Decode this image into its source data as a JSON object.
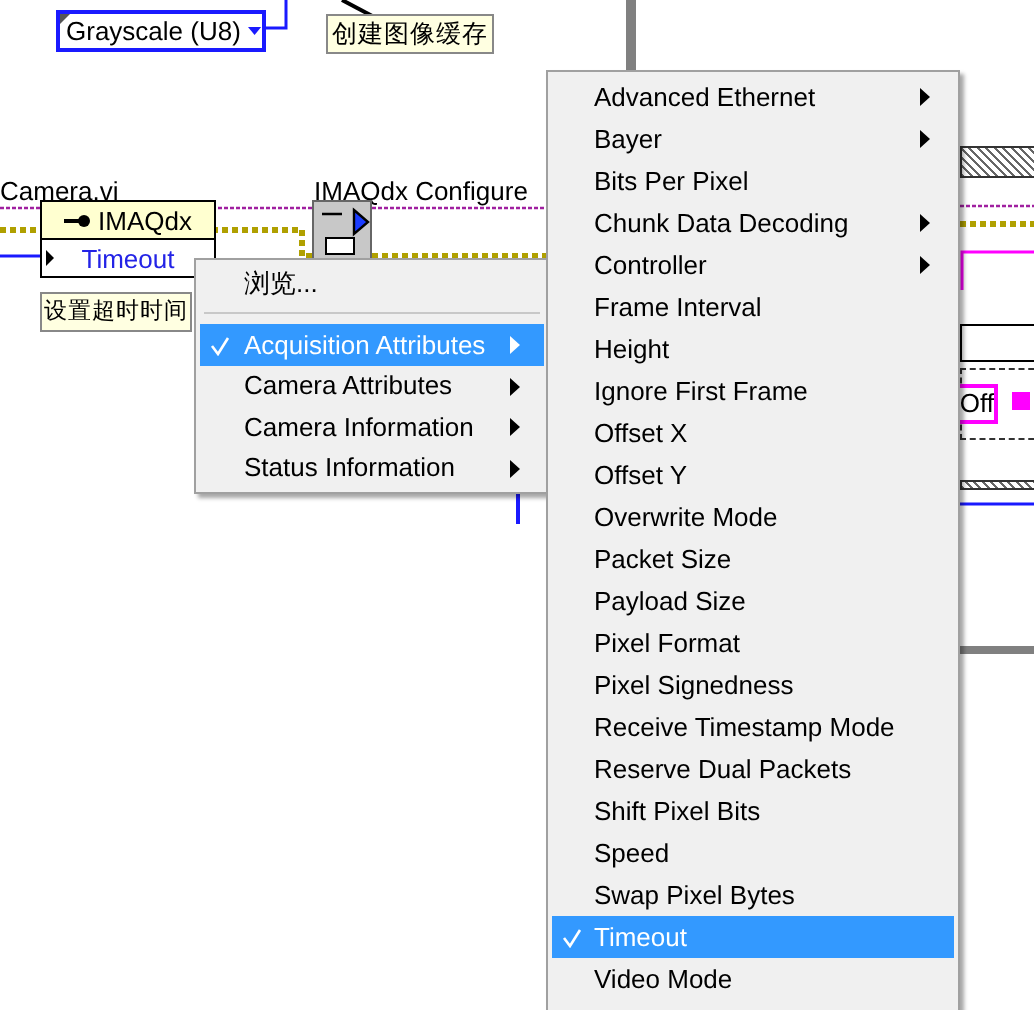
{
  "diagram": {
    "enum_constant": {
      "value": "Grayscale (U8)"
    },
    "buffer_label": "创建图像缓存",
    "vi_name": "Camera.vi",
    "property_node": {
      "class_name": "IMAQdx",
      "property": "Timeout"
    },
    "timeout_label": "设置超时时间",
    "subvi_label": "IMAQdx Configure",
    "ring_value": "Off"
  },
  "context_menu": {
    "items": [
      {
        "label": "浏览...",
        "checked": false,
        "selected": false,
        "has_submenu": false
      },
      {
        "label": "Acquisition Attributes",
        "checked": true,
        "selected": true,
        "has_submenu": true
      },
      {
        "label": "Camera Attributes",
        "checked": false,
        "selected": false,
        "has_submenu": true
      },
      {
        "label": "Camera Information",
        "checked": false,
        "selected": false,
        "has_submenu": true
      },
      {
        "label": "Status Information",
        "checked": false,
        "selected": false,
        "has_submenu": true
      }
    ]
  },
  "submenu": {
    "items": [
      {
        "label": "Advanced Ethernet",
        "checked": false,
        "selected": false,
        "has_submenu": true
      },
      {
        "label": "Bayer",
        "checked": false,
        "selected": false,
        "has_submenu": true
      },
      {
        "label": "Bits Per Pixel",
        "checked": false,
        "selected": false,
        "has_submenu": false
      },
      {
        "label": "Chunk Data Decoding",
        "checked": false,
        "selected": false,
        "has_submenu": true
      },
      {
        "label": "Controller",
        "checked": false,
        "selected": false,
        "has_submenu": true
      },
      {
        "label": "Frame Interval",
        "checked": false,
        "selected": false,
        "has_submenu": false
      },
      {
        "label": "Height",
        "checked": false,
        "selected": false,
        "has_submenu": false
      },
      {
        "label": "Ignore First Frame",
        "checked": false,
        "selected": false,
        "has_submenu": false
      },
      {
        "label": "Offset X",
        "checked": false,
        "selected": false,
        "has_submenu": false
      },
      {
        "label": "Offset Y",
        "checked": false,
        "selected": false,
        "has_submenu": false
      },
      {
        "label": "Overwrite Mode",
        "checked": false,
        "selected": false,
        "has_submenu": false
      },
      {
        "label": "Packet Size",
        "checked": false,
        "selected": false,
        "has_submenu": false
      },
      {
        "label": "Payload Size",
        "checked": false,
        "selected": false,
        "has_submenu": false
      },
      {
        "label": "Pixel Format",
        "checked": false,
        "selected": false,
        "has_submenu": false
      },
      {
        "label": "Pixel Signedness",
        "checked": false,
        "selected": false,
        "has_submenu": false
      },
      {
        "label": "Receive Timestamp Mode",
        "checked": false,
        "selected": false,
        "has_submenu": false
      },
      {
        "label": "Reserve Dual Packets",
        "checked": false,
        "selected": false,
        "has_submenu": false
      },
      {
        "label": "Shift Pixel Bits",
        "checked": false,
        "selected": false,
        "has_submenu": false
      },
      {
        "label": "Speed",
        "checked": false,
        "selected": false,
        "has_submenu": false
      },
      {
        "label": "Swap Pixel Bytes",
        "checked": false,
        "selected": false,
        "has_submenu": false
      },
      {
        "label": "Timeout",
        "checked": true,
        "selected": true,
        "has_submenu": false
      },
      {
        "label": "Video Mode",
        "checked": false,
        "selected": false,
        "has_submenu": false
      }
    ]
  }
}
